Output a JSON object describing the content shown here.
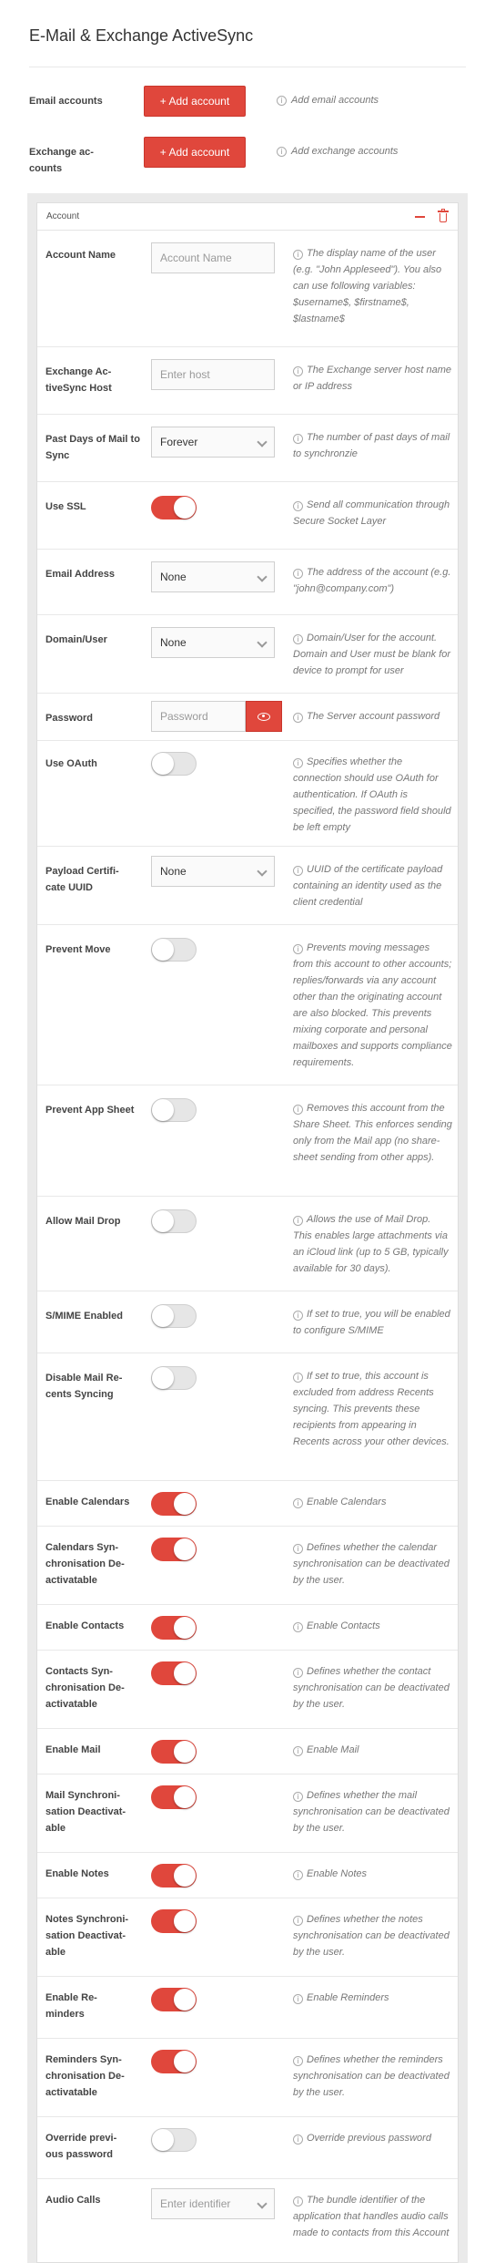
{
  "page": {
    "title": "E-Mail & Exchange ActiveSync"
  },
  "top": {
    "email_accounts": {
      "label": "Email accounts",
      "button": "+ Add account",
      "hint": "Add email accounts"
    },
    "exchange_accounts": {
      "label": "Exchange ac-\ncounts",
      "button": "+ Add account",
      "hint": "Add exchange accounts"
    }
  },
  "panel": {
    "title": "Account",
    "icons": [
      "minus-icon",
      "trash-icon"
    ]
  },
  "colors": {
    "accent": "#e0473c",
    "toggle_off": "#e6e6e6"
  },
  "fields": {
    "account_name": {
      "label": "Account Name",
      "placeholder": "Account Name",
      "hint": "The display name of the user (e.g. \"John Appleseed\"). You also can use following variables: $username$, $firstname$, $lastname$"
    },
    "host": {
      "label": "Exchange Ac-\ntiveSync Host",
      "placeholder": "Enter host",
      "hint": "The Exchange server host name or IP address"
    },
    "past_days": {
      "label": "Past Days of Mail to Sync",
      "value": "Forever",
      "hint": "The number of past days of mail to synchronzie"
    },
    "use_ssl": {
      "label": "Use SSL",
      "on": true,
      "hint": "Send all communication through Secure Socket Layer"
    },
    "email_address": {
      "label": "Email Address",
      "value": "None",
      "hint": "The address of the account (e.g. \"john@company.com\")"
    },
    "domain_user": {
      "label": "Domain/User",
      "value": "None",
      "hint": "Domain/User for the account. Domain and User must be blank for device to prompt for user"
    },
    "password": {
      "label": "Password",
      "placeholder": "Password",
      "hint": "The Server account password"
    },
    "use_oauth": {
      "label": "Use OAuth",
      "on": false,
      "hint": "Specifies whether the connection should use OAuth for authentication. If OAuth is specified, the password field should be left empty"
    },
    "payload_cert": {
      "label": "Payload Certifi-\ncate UUID",
      "value": "None",
      "hint": "UUID of the certificate payload containing an identity used as the client credential"
    },
    "prevent_move": {
      "label": "Prevent Move",
      "on": false,
      "hint": "Prevents moving messages from this account to other accounts; replies/forwards via any account other than the originating account are also blocked. This prevents mixing corporate and personal mailboxes and supports compliance requirements."
    },
    "prevent_app_sheet": {
      "label": "Prevent App Sheet",
      "on": false,
      "hint": "Removes this account from the Share Sheet. This enforces sending only from the Mail app (no share-sheet sending from other apps)."
    },
    "allow_mail_drop": {
      "label": "Allow Mail Drop",
      "on": false,
      "hint": "Allows the use of Mail Drop. This enables large attachments via an iCloud link (up to 5 GB, typically available for 30 days)."
    },
    "smime": {
      "label": "S/MIME Enabled",
      "on": false,
      "hint": "If set to true, you will be enabled to configure S/MIME"
    },
    "disable_recents": {
      "label": "Disable Mail Re-\ncents Syncing",
      "on": false,
      "hint": "If set to true, this account is excluded from address Recents syncing. This prevents these recipients from appearing in Recents across your other devices."
    },
    "enable_calendars": {
      "label": "Enable Calendars",
      "on": true,
      "hint": "Enable Calendars"
    },
    "calendars_deact": {
      "label": "Calendars Syn-\nchronisation De-\nactivatable",
      "on": true,
      "hint": "Defines whether the calendar synchronisation can be deactivated by the user."
    },
    "enable_contacts": {
      "label": "Enable Contacts",
      "on": true,
      "hint": "Enable Contacts"
    },
    "contacts_deact": {
      "label": "Contacts Syn-\nchronisation De-\nactivatable",
      "on": true,
      "hint": "Defines whether the contact synchronisation can be deactivated by the user."
    },
    "enable_mail": {
      "label": "Enable Mail",
      "on": true,
      "hint": "Enable Mail"
    },
    "mail_deact": {
      "label": "Mail Synchroni-\nsation Deactivat-\nable",
      "on": true,
      "hint": "Defines whether the mail synchronisation can be deactivated by the user."
    },
    "enable_notes": {
      "label": "Enable Notes",
      "on": true,
      "hint": "Enable Notes"
    },
    "notes_deact": {
      "label": "Notes Synchroni-\nsation Deactivat-\nable",
      "on": true,
      "hint": "Defines whether the notes synchronisation can be deactivated by the user."
    },
    "enable_reminders": {
      "label": "Enable Re-\nminders",
      "on": true,
      "hint": "Enable Reminders"
    },
    "reminders_deact": {
      "label": "Reminders Syn-\nchronisation De-\nactivatable",
      "on": true,
      "hint": "Defines whether the reminders synchronisation can be deactivated by the user."
    },
    "override_password": {
      "label": "Override previ-\nous password",
      "on": false,
      "hint": "Override previous password"
    },
    "audio_calls": {
      "label": "Audio Calls",
      "placeholder": "Enter identifier",
      "hint": "The bundle identifier of the application that handles audio calls made to contacts from this Account"
    }
  }
}
